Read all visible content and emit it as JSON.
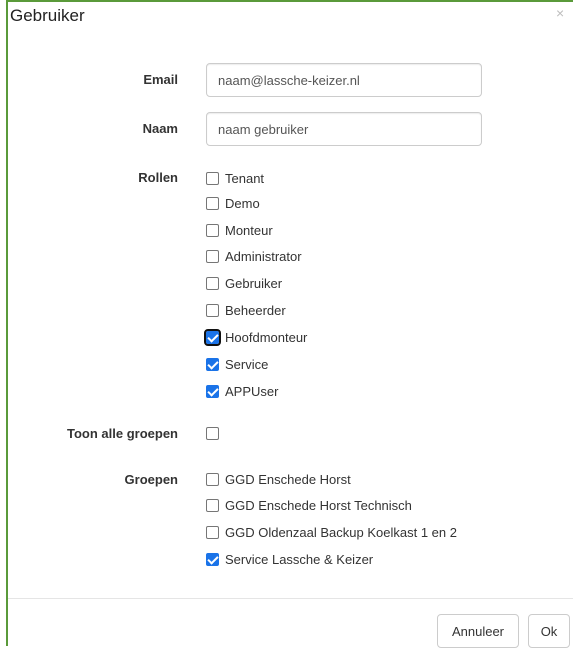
{
  "dialog": {
    "title": "Gebruiker",
    "close_symbol": "×"
  },
  "form": {
    "email_label": "Email",
    "email_value": "naam@lassche-keizer.nl",
    "naam_label": "Naam",
    "naam_value": "naam gebruiker",
    "rollen_label": "Rollen",
    "rollen": [
      {
        "label": "Tenant",
        "checked": false
      },
      {
        "label": "Demo",
        "checked": false
      },
      {
        "label": "Monteur",
        "checked": false
      },
      {
        "label": "Administrator",
        "checked": false
      },
      {
        "label": "Gebruiker",
        "checked": false
      },
      {
        "label": "Beheerder",
        "checked": false
      },
      {
        "label": "Hoofdmonteur",
        "checked": true
      },
      {
        "label": "Service",
        "checked": true
      },
      {
        "label": "APPUser",
        "checked": true
      }
    ],
    "toon_label": "Toon alle groepen",
    "toon_checked": false,
    "groepen_label": "Groepen",
    "groepen": [
      {
        "label": "GGD Enschede Horst",
        "checked": false
      },
      {
        "label": "GGD Enschede Horst Technisch",
        "checked": false
      },
      {
        "label": "GGD Oldenzaal Backup Koelkast 1 en 2",
        "checked": false
      },
      {
        "label": "Service Lassche & Keizer",
        "checked": true
      }
    ]
  },
  "footer": {
    "cancel_label": "Annuleer",
    "ok_label": "Ok"
  },
  "colors": {
    "accent_border": "#5a9a3a",
    "checkbox_checked": "#1a73e8"
  }
}
